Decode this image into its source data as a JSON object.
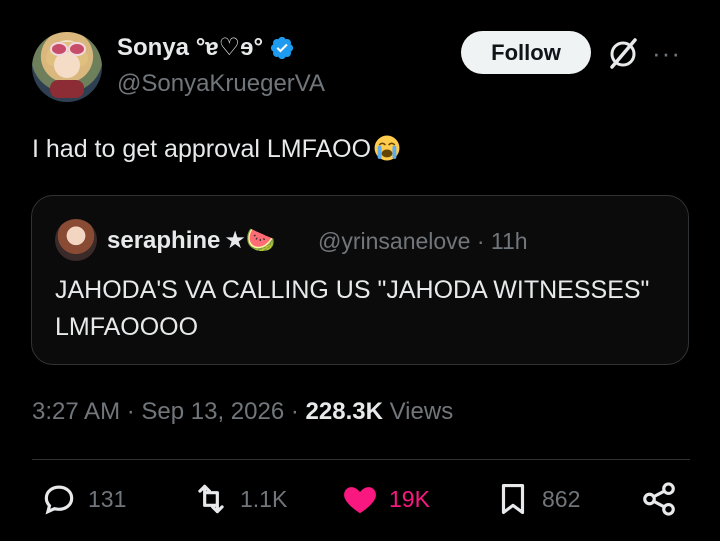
{
  "author": {
    "display_name": "Sonya °ɐ♡ɘ°",
    "handle": "@SonyaKruegerVA",
    "verified_color": "#1d9bf0"
  },
  "header": {
    "follow_label": "Follow",
    "more_label": "···"
  },
  "tweet": {
    "text": "I had to get approval LMFAOO",
    "emoji": "loudly-crying-face"
  },
  "quote": {
    "name": "seraphine",
    "name_suffix": "★🍉",
    "handle": "@yrinsanelove",
    "time": "· 11h",
    "text": "JAHODA'S VA CALLING US \"JAHODA WITNESSES\" LMFAOOOO"
  },
  "meta": {
    "time": "3:27 AM",
    "date": "Sep 13, 2026",
    "views_count": "228.3K",
    "views_label": "Views"
  },
  "actions": {
    "replies": "131",
    "retweets": "1.1K",
    "likes": "19K",
    "bookmarks": "862"
  },
  "colors": {
    "background": "#000000",
    "text": "#e7e9ea",
    "muted": "#71767b",
    "like": "#f91880",
    "border": "#2f3336"
  }
}
